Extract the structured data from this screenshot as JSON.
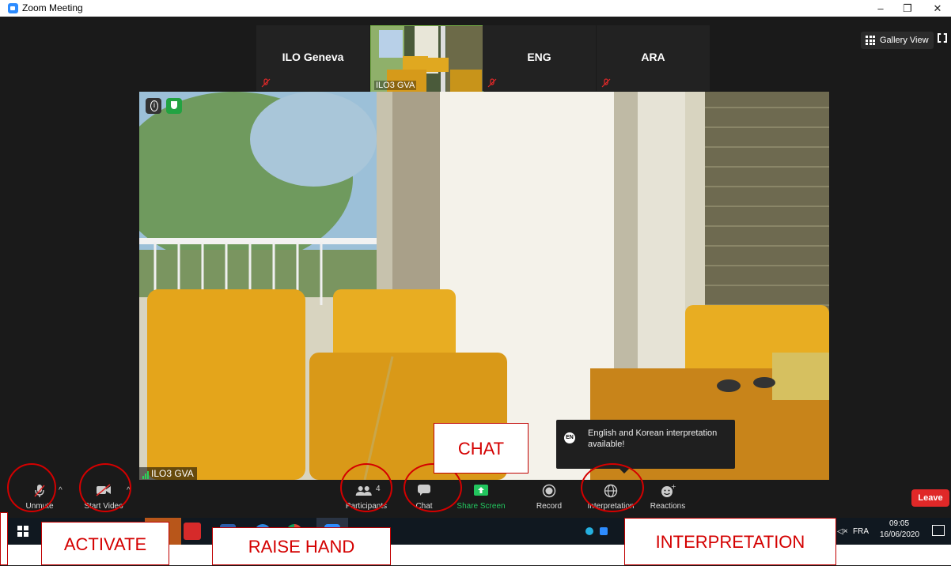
{
  "window": {
    "title": "Zoom Meeting",
    "minimize": "–",
    "restore": "❐",
    "close": "✕"
  },
  "thumbnails": [
    {
      "name": "ILO Geneva",
      "muted": true
    },
    {
      "name": "ILO3 GVA",
      "video": true
    },
    {
      "name": "ENG",
      "muted": true
    },
    {
      "name": "ARA",
      "muted": true
    }
  ],
  "view": {
    "gallery_label": "Gallery View"
  },
  "main_video": {
    "participant": "ILO3 GVA"
  },
  "toolbar": {
    "unmute": "Unmute",
    "start_video": "Start Video",
    "participants": "Participants",
    "participants_count": "4",
    "chat": "Chat",
    "share_screen": "Share Screen",
    "record": "Record",
    "interpretation": "Interpretation",
    "reactions": "Reactions",
    "leave": "Leave"
  },
  "tooltip": {
    "badge": "EN",
    "text": "English and Korean interpretation available!"
  },
  "taskbar": {
    "lang": "FRA",
    "time": "09:05",
    "date": "16/06/2020",
    "volume": "◁×"
  },
  "annotations": {
    "chat": "CHAT",
    "activate": "ACTIVATE",
    "raise_hand": "RAISE HAND",
    "interpretation": "INTERPRETATION"
  },
  "colors": {
    "accent_red": "#d40000",
    "share_green": "#22c55e",
    "leave_red": "#e02828",
    "zoom_blue": "#2d8cff"
  }
}
